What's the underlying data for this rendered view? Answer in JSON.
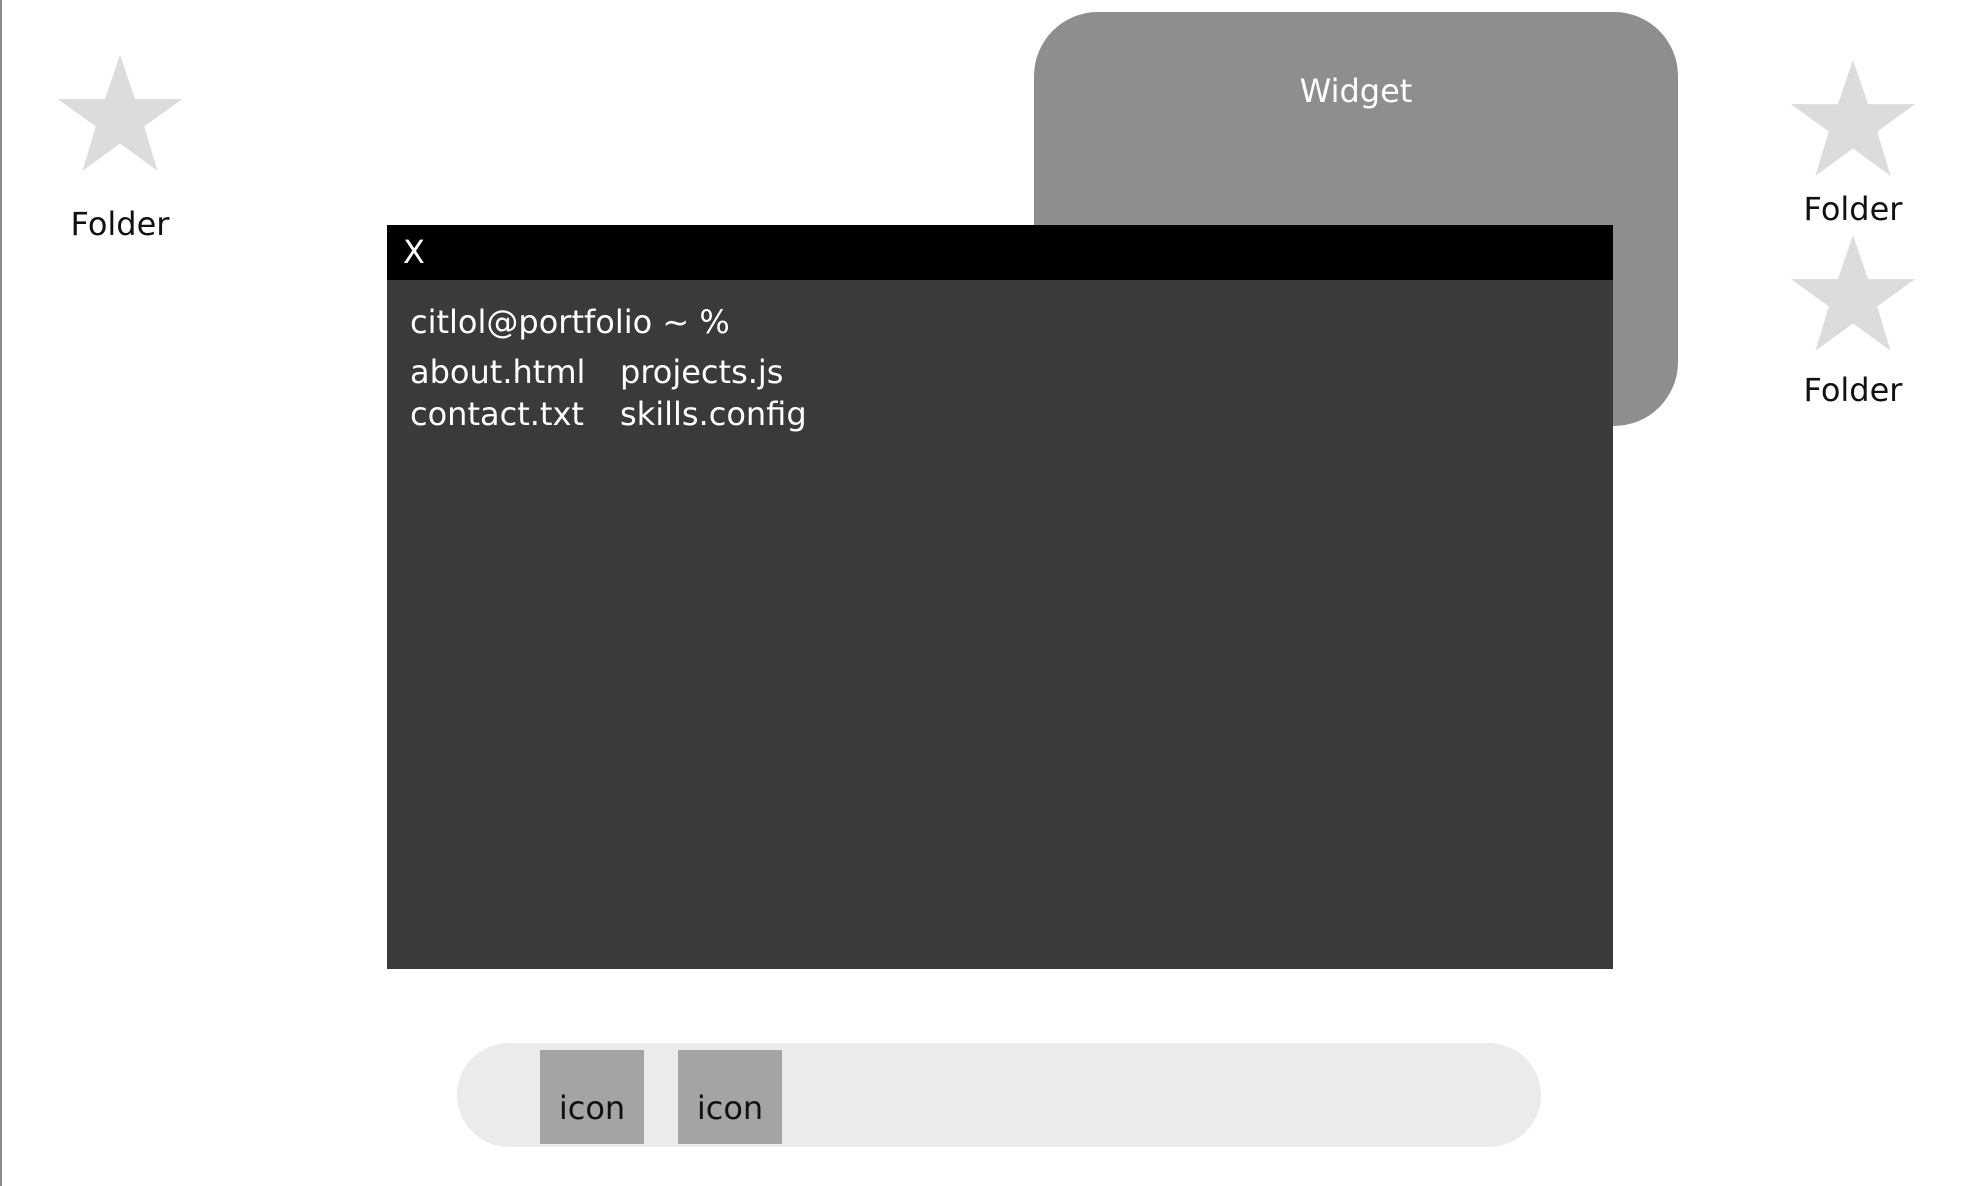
{
  "desktop": {
    "folders": [
      {
        "label": "Folder",
        "icon": "star-icon"
      },
      {
        "label": "Folder",
        "icon": "star-icon"
      },
      {
        "label": "Folder",
        "icon": "star-icon"
      }
    ]
  },
  "widget": {
    "title": "Widget"
  },
  "terminal": {
    "close_label": "X",
    "prompt": "citlol@portfolio ~ %",
    "files": [
      "about.html",
      "projects.js",
      "contact.txt",
      "skills.config"
    ]
  },
  "dock": {
    "items": [
      {
        "label": "icon"
      },
      {
        "label": "icon"
      }
    ]
  },
  "colors": {
    "terminal_bg": "#3a3a3a",
    "titlebar_bg": "#000000",
    "widget_bg": "#8e8e8e",
    "dock_bg": "#ebebeb",
    "dock_icon_bg": "#a4a4a4",
    "folder_icon": "#dcdcdc"
  }
}
